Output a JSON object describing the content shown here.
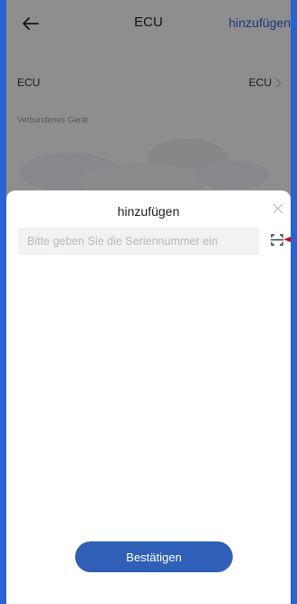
{
  "header": {
    "back_icon": "arrow-left-icon",
    "title": "ECU",
    "add_label": "hinzufügen"
  },
  "ecu_row": {
    "label": "ECU",
    "value": "ECU",
    "chevron_icon": "chevron-right-icon"
  },
  "device_section": {
    "label": "Verbundenes Gerät"
  },
  "sheet": {
    "title": "hinzufügen",
    "close_icon": "close-icon",
    "serial_input": {
      "placeholder": "Bitte geben Sie die Seriennummer ein",
      "value": ""
    },
    "scan_icon": "scan-icon",
    "confirm_label": "Bestätigen"
  },
  "colors": {
    "accent": "#2a63d3",
    "button": "#2f5fb6",
    "annotation_arrow": "#d0021b"
  }
}
